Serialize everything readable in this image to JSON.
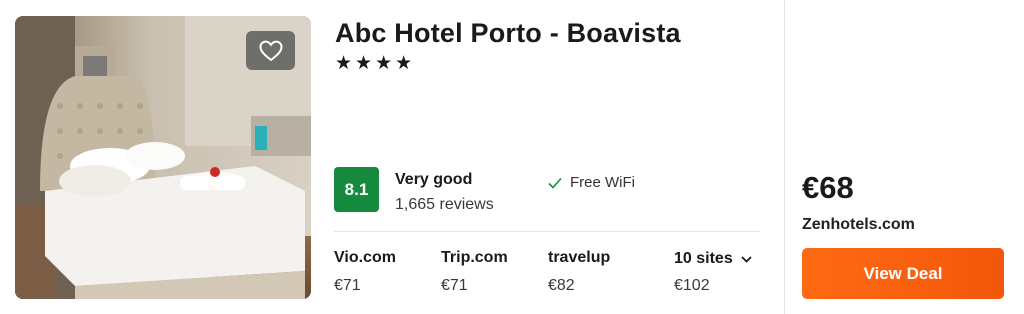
{
  "hotel": {
    "name": "Abc Hotel Porto - Boavista",
    "stars": "★★★★",
    "favorite_icon": "heart-outline-icon"
  },
  "rating": {
    "score": "8.1",
    "label": "Very good",
    "reviews": "1,665 reviews",
    "score_color": "#158a3e"
  },
  "amenities": [
    {
      "icon": "check-icon",
      "label": "Free WiFi"
    }
  ],
  "sites": [
    {
      "name": "Vio.com",
      "price": "€71"
    },
    {
      "name": "Trip.com",
      "price": "€71"
    },
    {
      "name": "travelup",
      "price": "€82"
    }
  ],
  "more_sites": {
    "label": "10 sites",
    "price": "€102",
    "icon": "chevron-down-icon"
  },
  "deal": {
    "price": "€68",
    "provider": "Zenhotels.com",
    "button_label": "View Deal",
    "button_color": "#ff6a14"
  }
}
